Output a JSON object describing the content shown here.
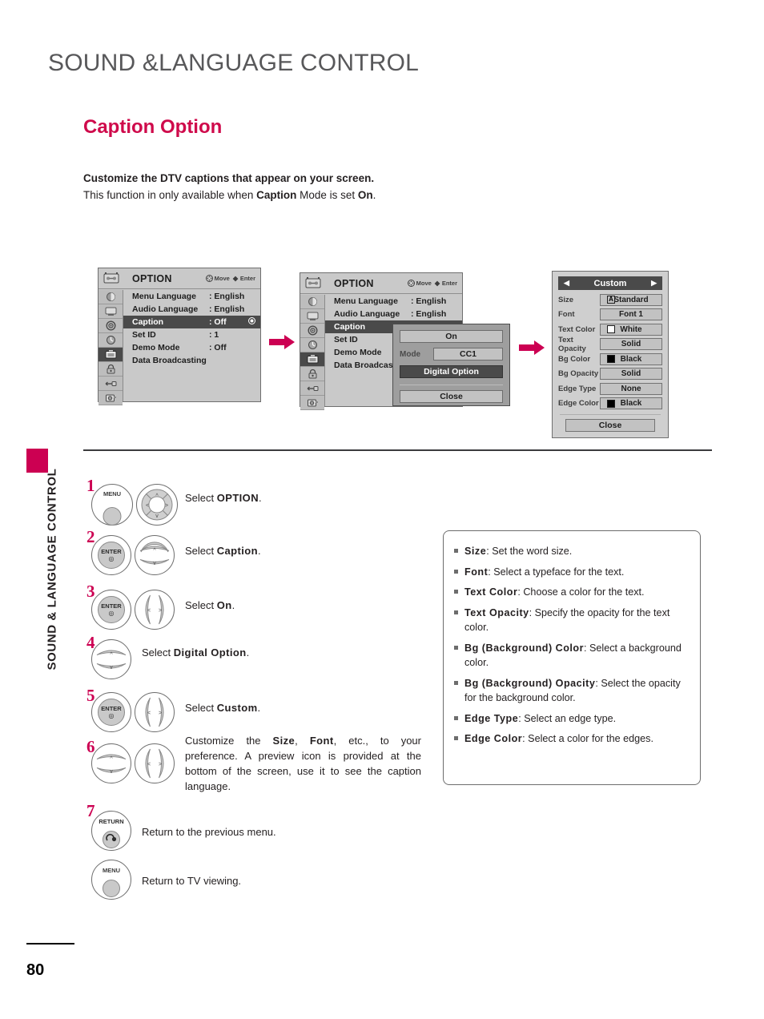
{
  "page": {
    "title": "SOUND &LANGUAGE CONTROL",
    "section": "Caption Option",
    "intro_line1": "Customize the DTV captions that appear on your screen.",
    "intro_line2_a": "This function in only available when ",
    "intro_line2_b": "Caption",
    "intro_line2_c": " Mode is set ",
    "intro_line2_d": "On",
    "intro_line2_e": ".",
    "side_label": "SOUND & LANGUAGE CONTROL",
    "page_number": "80",
    "accent_color": "#cc0052",
    "title_color": "#58585a"
  },
  "osd1": {
    "title": "OPTION",
    "hint_move": "Move",
    "hint_enter": "Enter",
    "rows": [
      {
        "label": "Menu Language",
        "value": ": English",
        "selected": false
      },
      {
        "label": "Audio Language",
        "value": ": English",
        "selected": false
      },
      {
        "label": "Caption",
        "value": ": Off",
        "selected": true
      },
      {
        "label": "Set ID",
        "value": ": 1",
        "selected": false
      },
      {
        "label": "Demo Mode",
        "value": ": Off",
        "selected": false
      },
      {
        "label": "Data Broadcasting",
        "value": "",
        "selected": false
      }
    ]
  },
  "osd2": {
    "title": "OPTION",
    "hint_move": "Move",
    "hint_enter": "Enter",
    "rows": [
      {
        "label": "Menu Language",
        "value": ": English",
        "selected": false
      },
      {
        "label": "Audio Language",
        "value": ": English",
        "selected": false
      },
      {
        "label": "Caption",
        "value": "",
        "selected": true
      },
      {
        "label": "Set ID",
        "value": "",
        "selected": false
      },
      {
        "label": "Demo Mode",
        "value": "",
        "selected": false
      },
      {
        "label": "Data Broadcasti",
        "value": "",
        "selected": false
      }
    ],
    "popup": {
      "on_label": "On",
      "mode_label": "Mode",
      "mode_value": "CC1",
      "digital_option": "Digital Option",
      "close": "Close"
    }
  },
  "osd3": {
    "header": "Custom",
    "left_arrow": "◀",
    "right_arrow": "▶",
    "rows": [
      {
        "label": "Size",
        "value": "Standard",
        "swatch": "letter-a"
      },
      {
        "label": "Font",
        "value": "Font 1",
        "swatch": "none"
      },
      {
        "label": "Text Color",
        "value": "White",
        "swatch": "#ffffff"
      },
      {
        "label": "Text Opacity",
        "value": "Solid",
        "swatch": "none"
      },
      {
        "label": "Bg Color",
        "value": "Black",
        "swatch": "#000000"
      },
      {
        "label": "Bg Opacity",
        "value": "Solid",
        "swatch": "none"
      },
      {
        "label": "Edge Type",
        "value": "None",
        "swatch": "none"
      },
      {
        "label": "Edge Color",
        "value": "Black",
        "swatch": "#000000"
      }
    ],
    "close": "Close"
  },
  "steps": [
    {
      "num": "1",
      "buttons": [
        "MENU",
        "navpad"
      ],
      "text_plain": "Select ",
      "text_bold": "OPTION",
      "text_tail": "."
    },
    {
      "num": "2",
      "buttons": [
        "ENTER",
        "updown"
      ],
      "text_plain": "Select ",
      "text_bold": "Caption",
      "text_tail": "."
    },
    {
      "num": "3",
      "buttons": [
        "ENTER",
        "leftright"
      ],
      "text_plain": "Select ",
      "text_bold": "On",
      "text_tail": "."
    },
    {
      "num": "4",
      "buttons": [
        "updown"
      ],
      "text_plain": "Select ",
      "text_bold": "Digital Option",
      "text_tail": "."
    },
    {
      "num": "5",
      "buttons": [
        "ENTER",
        "leftright"
      ],
      "text_plain": "Select ",
      "text_bold": "Custom",
      "text_tail": "."
    },
    {
      "num": "6",
      "buttons": [
        "updown",
        "leftright"
      ],
      "text_plain": "",
      "text_bold": "",
      "text_tail": ""
    },
    {
      "num": "7",
      "buttons": [
        "RETURN"
      ],
      "text_plain": "Return to the previous menu.",
      "text_bold": "",
      "text_tail": ""
    },
    {
      "num": "",
      "buttons": [
        "MENU"
      ],
      "text_plain": "Return to TV viewing.",
      "text_bold": "",
      "text_tail": ""
    }
  ],
  "step6": {
    "a": "Customize the ",
    "b": "Size",
    "c": ", ",
    "d": "Font",
    "e": ", etc., to your preference. A preview icon is provided at the bottom of the screen, use it to see the caption language."
  },
  "buttons": {
    "menu": "MENU",
    "enter": "ENTER",
    "return": "RETURN"
  },
  "infobox": [
    {
      "term": "Size",
      "desc": ": Set the word size."
    },
    {
      "term": "Font",
      "desc": ": Select a typeface for the text."
    },
    {
      "term": "Text Color",
      "desc": ": Choose a color for the text."
    },
    {
      "term": "Text Opacity",
      "desc": ": Specify the opacity for the text color."
    },
    {
      "term": "Bg (Background) Color",
      "desc": ": Select a background color."
    },
    {
      "term": "Bg (Background) Opacity",
      "desc": ": Select the opacity for the background color."
    },
    {
      "term": "Edge Type",
      "desc": ": Select an edge type."
    },
    {
      "term": "Edge Color",
      "desc": ": Select a color for the edges."
    }
  ]
}
